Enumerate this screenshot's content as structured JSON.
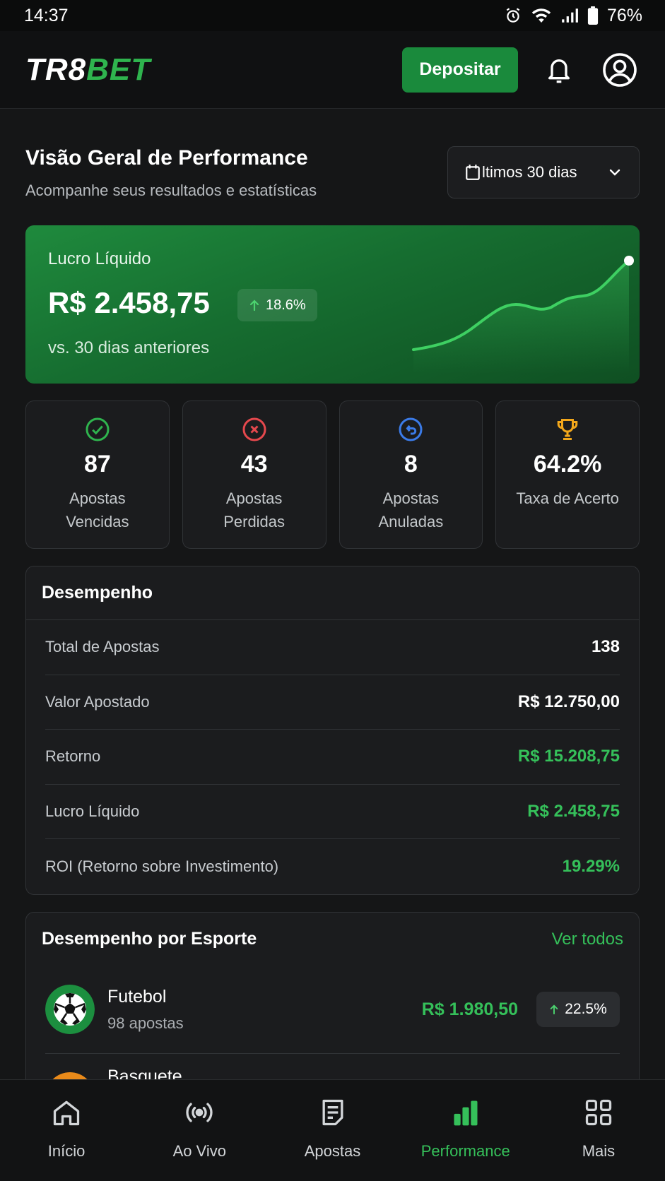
{
  "status_bar": {
    "time": "14:37",
    "battery": "76%"
  },
  "header": {
    "logo_part1": "TR8",
    "logo_part2": "BET",
    "deposit_label": "Depositar"
  },
  "page": {
    "title": "Visão Geral de Performance",
    "subtitle": "Acompanhe seus resultados e estatísticas",
    "period_label": "ltimos 30 dias"
  },
  "profit_card": {
    "label": "Lucro Líquido",
    "value": "R$ 2.458,75",
    "change": "18.6%",
    "comparison": "vs. 30 dias anteriores"
  },
  "stats": [
    {
      "icon": "check-circle-icon",
      "color": "#2fb44e",
      "value": "87",
      "label": "Apostas Vencidas"
    },
    {
      "icon": "x-circle-icon",
      "color": "#e5484d",
      "value": "43",
      "label": "Apostas Perdidas"
    },
    {
      "icon": "undo-circle-icon",
      "color": "#3b7be8",
      "value": "8",
      "label": "Apostas Anuladas"
    },
    {
      "icon": "trophy-icon",
      "color": "#f2a71b",
      "value": "64.2%",
      "label": "Taxa de Acerto"
    }
  ],
  "performance": {
    "title": "Desempenho",
    "rows": [
      {
        "label": "Total de Apostas",
        "value": "138"
      },
      {
        "label": "Valor Apostado",
        "value": "R$ 12.750,00"
      },
      {
        "label": "Retorno",
        "value": "R$ 15.208,75"
      },
      {
        "label": "Lucro Líquido",
        "value": "R$ 2.458,75"
      },
      {
        "label": "ROI (Retorno sobre Investimento)",
        "value": "19.29%"
      }
    ]
  },
  "sports": {
    "title": "Desempenho por Esporte",
    "link": "Ver todos",
    "items": [
      {
        "name": "Futebol",
        "count": "98 apostas",
        "amount": "R$ 1.980,50",
        "change": "22.5%"
      },
      {
        "name": "Basquete"
      }
    ]
  },
  "nav": [
    {
      "label": "Início",
      "icon": "home-icon"
    },
    {
      "label": "Ao Vivo",
      "icon": "live-broadcast-icon"
    },
    {
      "label": "Apostas",
      "icon": "bet-slip-icon"
    },
    {
      "label": "Performance",
      "icon": "bar-chart-icon",
      "active": true
    },
    {
      "label": "Mais",
      "icon": "grid-icon"
    }
  ],
  "colors": {
    "accent": "#35c05a",
    "brand_green": "#1a8a3c",
    "background": "#151617"
  }
}
